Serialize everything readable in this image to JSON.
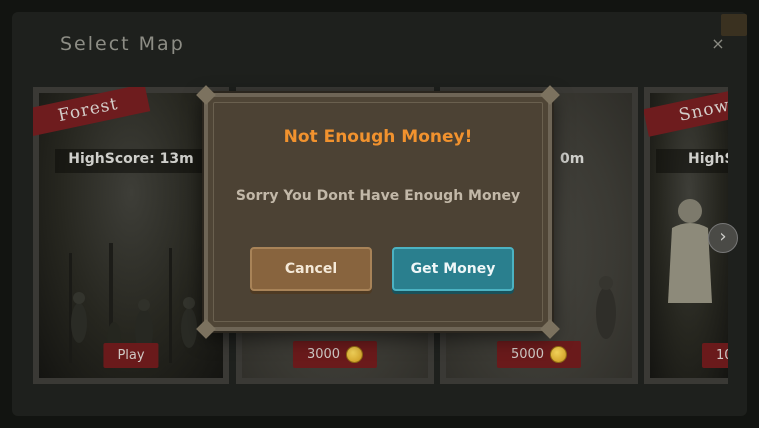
{
  "header": {
    "title": "Select Map",
    "close_glyph": "×"
  },
  "maps": [
    {
      "name": "Forest",
      "highscore": "HighScore: 13m",
      "action_label": "Play",
      "locked": false
    },
    {
      "name": "",
      "highscore": "",
      "action_label": "3000",
      "locked": true
    },
    {
      "name": "",
      "highscore": "e: 0m",
      "action_label": "5000",
      "locked": true
    },
    {
      "name": "Snow",
      "highscore": "HighS",
      "action_label": "10",
      "locked": true
    }
  ],
  "navigation": {
    "next_glyph": "›"
  },
  "dialog": {
    "title": "Not Enough Money!",
    "message": "Sorry You Dont Have Enough Money",
    "cancel_label": "Cancel",
    "get_money_label": "Get Money"
  },
  "colors": {
    "dialog_title": "#f1922e",
    "cancel_button": "#88643e",
    "get_money_button": "#2a7f8e",
    "map_banner": "#6e1c1e"
  },
  "icons": {
    "currency": "coin-icon",
    "close": "close-icon",
    "next": "chevron-right-icon"
  }
}
